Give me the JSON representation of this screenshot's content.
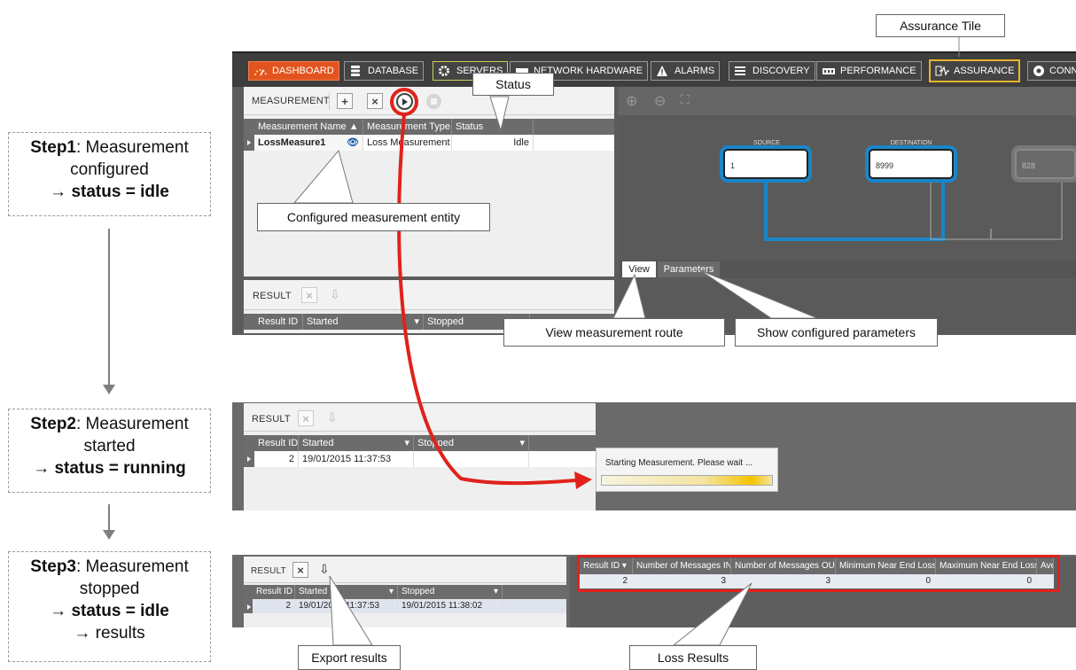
{
  "steps": [
    {
      "label": "Step1",
      "rest": ": Measurement",
      "line2": "configured",
      "status": "status = idle",
      "extra": ""
    },
    {
      "label": "Step2",
      "rest": ": Measurement",
      "line2": "started",
      "status": "status = running",
      "extra": ""
    },
    {
      "label": "Step3",
      "rest": ": Measurement",
      "line2": "stopped",
      "status": "status = idle",
      "extra": "results"
    }
  ],
  "arrow_glyph": "→",
  "callouts": {
    "assurance_tile": "Assurance Tile",
    "status": "Status",
    "configured_entity": "Configured measurement entity",
    "view_route": "View measurement route",
    "show_params": "Show configured parameters",
    "export_results": "Export results",
    "loss_results": "Loss Results"
  },
  "nav": {
    "tiles": [
      {
        "label": "DASHBOARD",
        "icon": "dashboard-icon"
      },
      {
        "label": "DATABASE",
        "icon": "database-icon"
      },
      {
        "label": "SERVERS",
        "icon": "gear-icon"
      },
      {
        "label": "NETWORK HARDWARE",
        "icon": "hardware-icon"
      },
      {
        "label": "ALARMS",
        "icon": "warning-icon"
      },
      {
        "label": "DISCOVERY",
        "icon": "list-icon"
      },
      {
        "label": "PERFORMANCE",
        "icon": "performance-icon"
      },
      {
        "label": "ASSURANCE",
        "icon": "pulse-icon"
      },
      {
        "label": "CONN",
        "icon": "connection-icon"
      }
    ],
    "active": "DASHBOARD",
    "highlight": "ASSURANCE"
  },
  "measurement_panel": {
    "title": "MEASUREMENT",
    "columns": [
      "Measurement Name",
      "Measurement Type",
      "Status"
    ],
    "row": {
      "name": "LossMeasure1",
      "type": "Loss Measurement",
      "status": "Idle"
    }
  },
  "route_view": {
    "source_label": "SOURCE",
    "destination_label": "DESTINATION",
    "source_value": "1",
    "destination_value": "8999",
    "third_value": "828",
    "tabs": [
      "View",
      "Parameters"
    ]
  },
  "result_panel": {
    "title": "RESULT",
    "columns": [
      "Result ID",
      "Started",
      "Stopped"
    ]
  },
  "step2": {
    "row": {
      "id": "2",
      "started": "19/01/2015 11:37:53",
      "stopped": ""
    },
    "progress_text": "Starting Measurement. Please wait ..."
  },
  "step3": {
    "row": {
      "id": "2",
      "started": "19/01/2015 11:37:53",
      "stopped": "19/01/2015 11:38:02"
    },
    "loss_columns": [
      "Result ID",
      "Number of Messages IN",
      "Number of Messages OUT",
      "Minimum Near End Loss",
      "Maximum Near End Loss",
      "Aver"
    ],
    "loss_row": [
      "2",
      "3",
      "3",
      "0",
      "0",
      ""
    ]
  },
  "colors": {
    "accent_red": "#e0221b",
    "assurance_border": "#e8b52e",
    "route_blue": "#1a86c8"
  }
}
